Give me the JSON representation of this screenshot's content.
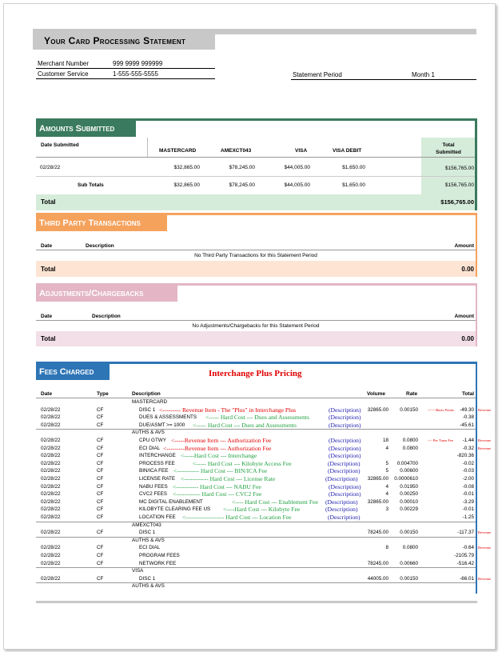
{
  "header": {
    "title": "Your Card Processing Statement"
  },
  "info": {
    "merchant_label": "Merchant Number",
    "merchant_value": "999 9999 999999",
    "service_label": "Customer Service",
    "service_value": "1-555-555-5555",
    "period_label": "Statement Period",
    "period_value": "Month 1"
  },
  "amounts": {
    "title": "Amounts Submitted",
    "col_date": "Date Submitted",
    "col_mc": "MASTERCARD",
    "col_amex": "AMEXCT043",
    "col_visa": "VISA",
    "col_visadebit": "VISA DEBIT",
    "col_total": "Total Submitted",
    "row_date": "02/28/22",
    "row_mc": "$32,865.00",
    "row_amex": "$78,245.00",
    "row_visa": "$44,005.00",
    "row_visadebit": "$1,650.00",
    "row_total": "$156,765.00",
    "sub_label": "Sub Totals",
    "sub_mc": "$32,865.00",
    "sub_amex": "$78,245.00",
    "sub_visa": "$44,005.00",
    "sub_visadebit": "$1,650.00",
    "sub_total": "$156,765.00",
    "total_label": "Total",
    "total_value": "$156,765.00",
    "color": "#3a7a5e"
  },
  "third_party": {
    "title": "Third Party Transactions",
    "col_date": "Date",
    "col_desc": "Description",
    "col_amount": "Amount",
    "empty": "No Third Party Transactions for this Statement Period",
    "total_label": "Total",
    "total_value": "0.00",
    "color": "#f5a25d"
  },
  "adjustments": {
    "title": "Adjustments/Chargebacks",
    "col_date": "Date",
    "col_desc": "Description",
    "col_amount": "Amount",
    "empty": "No Adjustments/Chargebacks for this Statement Period",
    "total_label": "Total",
    "total_value": "0.00",
    "color": "#e3b5c5"
  },
  "fees": {
    "title": "Fees Charged",
    "pricing_note": "Interchange Plus Pricing",
    "col_date": "Date",
    "col_type": "Type",
    "col_desc": "Description",
    "col_volume": "Volume",
    "col_rate": "Rate",
    "col_total": "Total",
    "color": "#2e75b6",
    "rows": [
      {
        "date": "",
        "type": "",
        "desc": "MASTERCARD",
        "indent": 0,
        "volume": "",
        "rate": "",
        "total": "",
        "ann": "",
        "ann_color": "",
        "d": "",
        "side": "",
        "side_pre": ""
      },
      {
        "date": "02/28/22",
        "type": "CF",
        "desc": "DISC 1",
        "indent": 1,
        "volume": "32865.00",
        "rate": "0.00150",
        "total": "-49.30",
        "ann": "<--------- Revenue Item - The \"Plus\" in Interchange Plus",
        "ann_color": "red",
        "d": "(Description)",
        "side": "Revenue",
        "side_pre": "<-----Basis Points"
      },
      {
        "date": "02/28/22",
        "type": "CF",
        "desc": "DUES & ASSESSMENTS",
        "indent": 1,
        "volume": "",
        "rate": "",
        "total": "-0.38",
        "ann": "<----- Hard Cost --- Dues and Assessments",
        "ann_color": "green",
        "d": "(Description)",
        "side": "",
        "side_pre": ""
      },
      {
        "date": "02/28/22",
        "type": "CF",
        "desc": "DUE/ASMT >= 1000",
        "indent": 1,
        "volume": "",
        "rate": "",
        "total": "-45.61",
        "ann": "<----- Hard Cost --- Dues and Assessments",
        "ann_color": "green",
        "d": "(Description)",
        "side": "",
        "side_pre": ""
      },
      {
        "date": "",
        "type": "",
        "desc": "AUTHS & AVS",
        "indent": 0,
        "volume": "",
        "rate": "",
        "total": "",
        "ann": "",
        "ann_color": "",
        "d": "",
        "side": "",
        "side_pre": ""
      },
      {
        "date": "02/28/22",
        "type": "CF",
        "desc": "CPU GTWY",
        "indent": 1,
        "volume": "18",
        "rate": "0.0800",
        "total": "-1.44",
        "ann": "<-----Revenue Item --- Authorization Fee",
        "ann_color": "red",
        "d": "(Description)",
        "side": "Revenue",
        "side_pre": "<-- Per Trans Fee"
      },
      {
        "date": "02/28/22",
        "type": "CF",
        "desc": "ECI DIAL",
        "indent": 1,
        "volume": "4",
        "rate": "0.0800",
        "total": "-0.32",
        "ann": "<---------Revenue Item --- Authorization Fee",
        "ann_color": "red",
        "d": "(Description)",
        "side": "Revenue",
        "side_pre": ""
      },
      {
        "date": "02/28/22",
        "type": "CF",
        "desc": "INTERCHANGE",
        "indent": 1,
        "volume": "",
        "rate": "",
        "total": "-820.36",
        "ann": "<-----Hard Cost --- Interchange",
        "ann_color": "green",
        "d": "(Description)",
        "side": "",
        "side_pre": ""
      },
      {
        "date": "02/28/22",
        "type": "CF",
        "desc": "PROCESS FEE",
        "indent": 1,
        "volume": "5",
        "rate": "0.004700",
        "total": "-0.02",
        "ann": "<----- Hard Cost --- Kilobyte Access Fee",
        "ann_color": "green",
        "d": "(Description)",
        "side": "",
        "side_pre": ""
      },
      {
        "date": "02/28/22",
        "type": "CF",
        "desc": "BIN/ICA FEE",
        "indent": 1,
        "volume": "5",
        "rate": "0.00600",
        "total": "-0.03",
        "ann": "<----------- Hard Cost --- BIN/ICA Fee",
        "ann_color": "green",
        "d": "(Description)",
        "side": "",
        "side_pre": ""
      },
      {
        "date": "02/28/22",
        "type": "CF",
        "desc": "LICENSE RATE",
        "indent": 1,
        "volume": "32865.00",
        "rate": "0.0000610",
        "total": "-2.00",
        "ann": "<------------ Hard Cost --- License Rate",
        "ann_color": "green",
        "d": "(Description)",
        "side": "",
        "side_pre": ""
      },
      {
        "date": "02/28/22",
        "type": "CF",
        "desc": "NABU FEES",
        "indent": 1,
        "volume": "4",
        "rate": "0.01950",
        "total": "-0.08",
        "ann": "<----------- Hard Cost --- NABU Fee",
        "ann_color": "green",
        "d": "(Description)",
        "side": "",
        "side_pre": ""
      },
      {
        "date": "02/28/22",
        "type": "CF",
        "desc": "CVC2 FEES",
        "indent": 1,
        "volume": "4",
        "rate": "0.00250",
        "total": "-0.01",
        "ann": "<------------ Hard Cost --- CVC2 Fee",
        "ann_color": "green",
        "d": "(Description)",
        "side": "",
        "side_pre": ""
      },
      {
        "date": "02/28/22",
        "type": "CF",
        "desc": "MC DIGITAL ENABLEMENT",
        "indent": 1,
        "volume": "32865.00",
        "rate": "0.00010",
        "total": "-3.29",
        "ann": "<---- Hard Cost --- Enablement Fee",
        "ann_color": "green",
        "d": "(Description)",
        "side": "",
        "side_pre": ""
      },
      {
        "date": "02/28/22",
        "type": "CF",
        "desc": "KILOBYTE CLEARING FEE US",
        "indent": 1,
        "volume": "3",
        "rate": "0.00229",
        "total": "-0.01",
        "ann": "<----Hard Cost --- Kilobyte Fee",
        "ann_color": "green",
        "d": "(Description)",
        "side": "",
        "side_pre": ""
      },
      {
        "date": "02/28/22",
        "type": "CF",
        "desc": "LOCATION FEE",
        "indent": 1,
        "volume": "",
        "rate": "",
        "total": "-1.25",
        "ann": "<------------------- Hard Cost --- Location Fee",
        "ann_color": "green",
        "d": "(Description)",
        "side": "",
        "side_pre": ""
      },
      {
        "date": "",
        "type": "",
        "desc": "AMEXCT043",
        "indent": 0,
        "volume": "",
        "rate": "",
        "total": "",
        "ann": "",
        "ann_color": "",
        "d": "",
        "side": "",
        "side_pre": ""
      },
      {
        "date": "02/28/22",
        "type": "CF",
        "desc": "DISC 1",
        "indent": 1,
        "volume": "78245.00",
        "rate": "0.00150",
        "total": "-117.37",
        "ann": "",
        "ann_color": "",
        "d": "",
        "side": "Revenue",
        "side_pre": ""
      },
      {
        "date": "",
        "type": "",
        "desc": "AUTHS & AVS",
        "indent": 0,
        "volume": "",
        "rate": "",
        "total": "",
        "ann": "",
        "ann_color": "",
        "d": "",
        "side": "",
        "side_pre": ""
      },
      {
        "date": "02/28/22",
        "type": "CF",
        "desc": "ECI DIAL",
        "indent": 1,
        "volume": "8",
        "rate": "0.0800",
        "total": "-0.64",
        "ann": "",
        "ann_color": "",
        "d": "",
        "side": "Revenue",
        "side_pre": ""
      },
      {
        "date": "02/28/22",
        "type": "CF",
        "desc": "PROGRAM FEES",
        "indent": 1,
        "volume": "",
        "rate": "",
        "total": "-2105.79",
        "ann": "",
        "ann_color": "",
        "d": "",
        "side": "",
        "side_pre": ""
      },
      {
        "date": "02/28/22",
        "type": "CF",
        "desc": "NETWORK FEE",
        "indent": 1,
        "volume": "78245.00",
        "rate": "0.00660",
        "total": "-516.42",
        "ann": "",
        "ann_color": "",
        "d": "",
        "side": "",
        "side_pre": ""
      },
      {
        "date": "",
        "type": "",
        "desc": "VISA",
        "indent": 0,
        "volume": "",
        "rate": "",
        "total": "",
        "ann": "",
        "ann_color": "",
        "d": "",
        "side": "",
        "side_pre": ""
      },
      {
        "date": "02/28/22",
        "type": "CF",
        "desc": "DISC 1",
        "indent": 1,
        "volume": "44005.00",
        "rate": "0.00150",
        "total": "-66.01",
        "ann": "",
        "ann_color": "",
        "d": "",
        "side": "Revenue",
        "side_pre": ""
      },
      {
        "date": "",
        "type": "",
        "desc": "AUTHS & AVS",
        "indent": 0,
        "volume": "",
        "rate": "",
        "total": "",
        "ann": "",
        "ann_color": "",
        "d": "",
        "side": "",
        "side_pre": ""
      }
    ]
  }
}
